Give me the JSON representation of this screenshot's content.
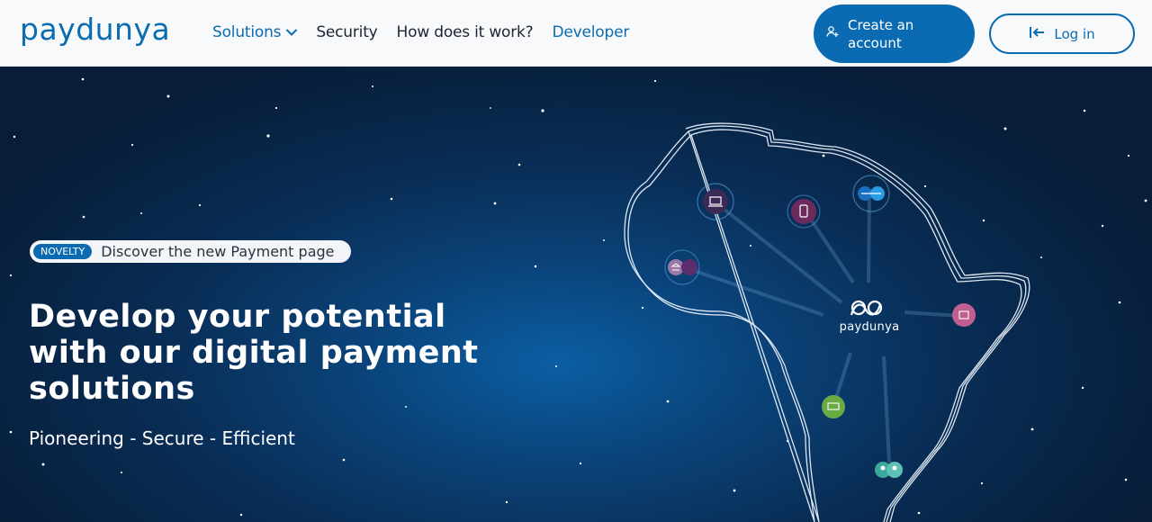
{
  "header": {
    "logo": "paydunya",
    "nav": [
      {
        "label": "Solutions",
        "has_dropdown": true,
        "color": "#0b6cb0"
      },
      {
        "label": "Security",
        "has_dropdown": false,
        "color": "#1d2433"
      },
      {
        "label": "How does it work?",
        "has_dropdown": false,
        "color": "#1d2433"
      },
      {
        "label": "Developer",
        "has_dropdown": false,
        "color": "#0b6cb0"
      }
    ],
    "create_account": {
      "label": "Create an account",
      "icon": "user-plus-icon"
    },
    "login": {
      "label": "Log in",
      "icon": "login-arrow-icon"
    }
  },
  "hero": {
    "badge": {
      "tag": "NOVELTY",
      "text": "Discover the new Payment page"
    },
    "headline": "Develop your potential with our digital payment solutions",
    "tagline": "Pioneering - Secure - Efficient",
    "map_logo": "paydunya",
    "nodes": [
      {
        "icon": "laptop-icon",
        "color": "#4b2a5c"
      },
      {
        "icon": "phone-icon",
        "color": "#7a2e64"
      },
      {
        "icon": "transfer-icon",
        "color": "#1e88d8"
      },
      {
        "icon": "bank-icon",
        "color": "#8a5a92"
      },
      {
        "icon": "shop-icon",
        "color": "#c45d8e"
      },
      {
        "icon": "money-icon",
        "color": "#6ab04c"
      },
      {
        "icon": "people-icon",
        "color": "#43b3a8"
      }
    ]
  },
  "colors": {
    "brand": "#0a6bb2",
    "hero_dark": "#071d38"
  }
}
